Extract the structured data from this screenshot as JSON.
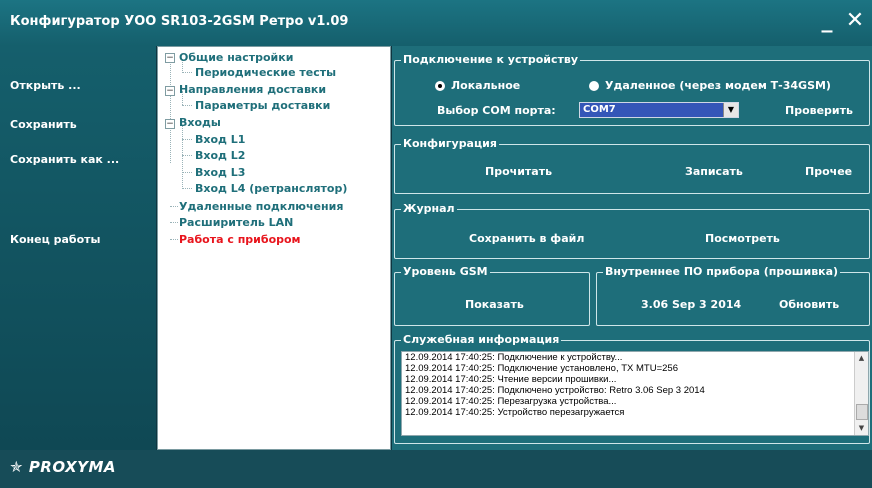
{
  "window": {
    "title": "Конфигуратор УОО SR103-2GSM Ретро v1.09",
    "minimize_glyph": "_",
    "close_glyph": "✕"
  },
  "sidebar": {
    "items": [
      {
        "label": "Открыть ..."
      },
      {
        "label": "Сохранить"
      },
      {
        "label": "Сохранить как ..."
      },
      {
        "label": "Конец работы"
      }
    ]
  },
  "tree": {
    "nodes": [
      {
        "label": "Общие настройки",
        "expander": "−"
      },
      {
        "label": "Периодические тесты"
      },
      {
        "label": "Направления доставки",
        "expander": "−"
      },
      {
        "label": "Параметры доставки"
      },
      {
        "label": "Входы",
        "expander": "−"
      },
      {
        "label": "Вход L1"
      },
      {
        "label": "Вход L2"
      },
      {
        "label": "Вход L3"
      },
      {
        "label": "Вход L4 (ретранслятор)"
      },
      {
        "label": "Удаленные подключения"
      },
      {
        "label": "Расширитель LAN"
      },
      {
        "label": "Работа с прибором",
        "color": "#e8151d"
      }
    ]
  },
  "connection": {
    "legend": "Подключение к устройству",
    "local_label": "Локальное",
    "remote_label": "Удаленное (через модем Т-34GSM)",
    "selected": "local",
    "com_label": "Выбор COM порта:",
    "com_value": "COM7",
    "check_button": "Проверить"
  },
  "configuration": {
    "legend": "Конфигурация",
    "read_button": "Прочитать",
    "write_button": "Записать",
    "other_button": "Прочее"
  },
  "journal": {
    "legend": "Журнал",
    "save_button": "Сохранить в файл",
    "view_button": "Посмотреть"
  },
  "gsm": {
    "legend": "Уровень GSM",
    "show_button": "Показать"
  },
  "firmware": {
    "legend": "Внутреннее ПО прибора (прошивка)",
    "version": "3.06 Sep  3 2014",
    "update_button": "Обновить"
  },
  "service": {
    "legend": "Служебная информация",
    "lines": [
      "12.09.2014 17:40:25: Подключение к устройству...",
      "12.09.2014 17:40:25: Подключение установлено, TX MTU=256",
      "12.09.2014 17:40:25: Чтение версии прошивки...",
      "12.09.2014 17:40:25: Подключено устройство: Retro 3.06 Sep  3 2014",
      "12.09.2014 17:40:25: Перезагрузка устройства...",
      "12.09.2014 17:40:25: Устройство перезагружается"
    ]
  },
  "footer": {
    "logo": "PROXYMA",
    "logo_star": "✯"
  },
  "colors": {
    "accent": "#1e6e7a",
    "tree_text": "#1f6f7a",
    "tree_active": "#e8151d",
    "combo": "#3456b8"
  }
}
